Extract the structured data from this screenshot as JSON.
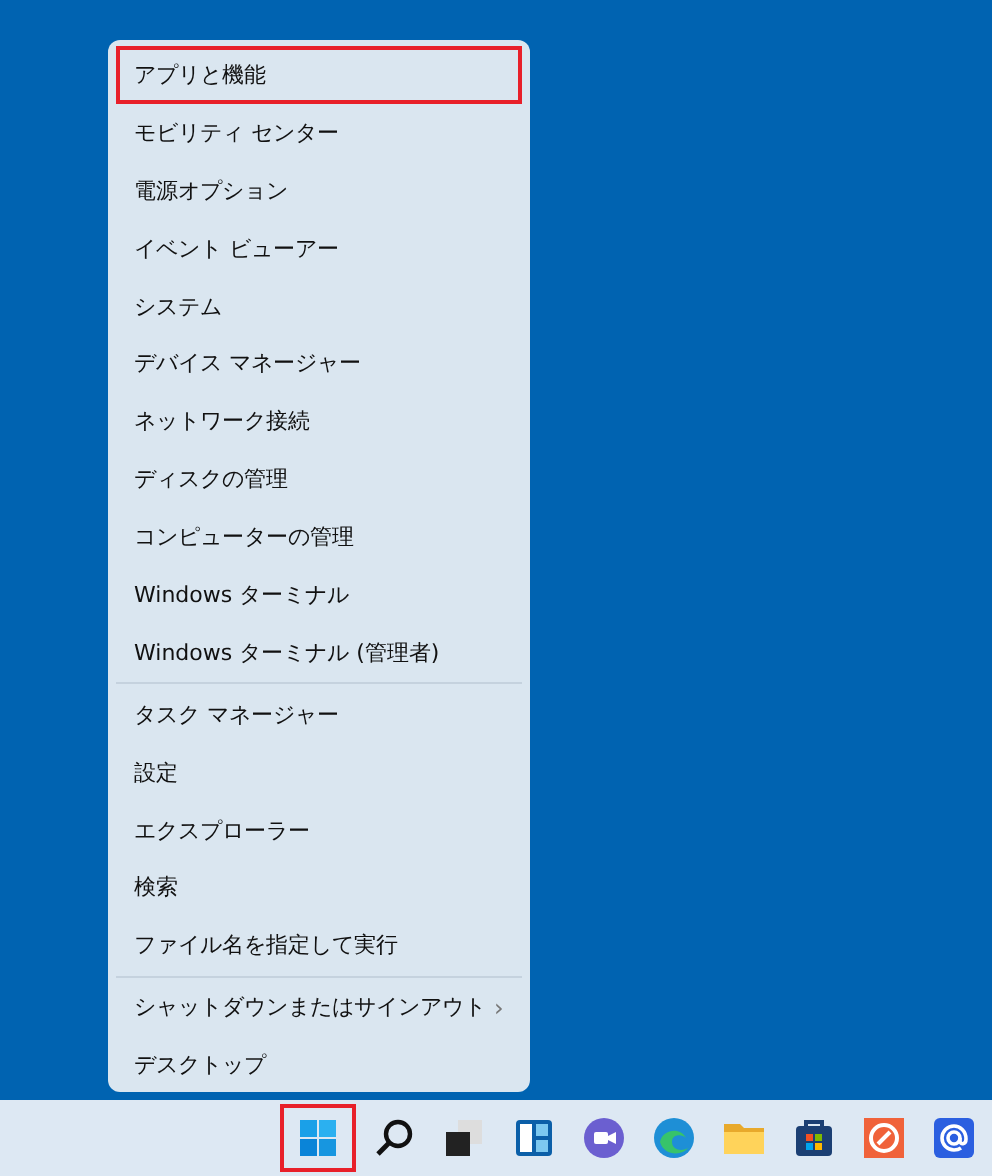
{
  "context_menu": {
    "groups": [
      {
        "items": [
          {
            "label": "アプリと機能",
            "highlighted": true
          },
          {
            "label": "モビリティ センター",
            "highlighted": false
          },
          {
            "label": "電源オプション",
            "highlighted": false
          },
          {
            "label": "イベント ビューアー",
            "highlighted": false
          },
          {
            "label": "システム",
            "highlighted": false
          },
          {
            "label": "デバイス マネージャー",
            "highlighted": false
          },
          {
            "label": "ネットワーク接続",
            "highlighted": false
          },
          {
            "label": "ディスクの管理",
            "highlighted": false
          },
          {
            "label": "コンピューターの管理",
            "highlighted": false
          },
          {
            "label": "Windows ターミナル",
            "highlighted": false
          },
          {
            "label": "Windows ターミナル (管理者)",
            "highlighted": false
          }
        ]
      },
      {
        "items": [
          {
            "label": "タスク マネージャー",
            "highlighted": false
          },
          {
            "label": "設定",
            "highlighted": false
          },
          {
            "label": "エクスプローラー",
            "highlighted": false
          },
          {
            "label": "検索",
            "highlighted": false
          },
          {
            "label": "ファイル名を指定して実行",
            "highlighted": false
          }
        ]
      },
      {
        "items": [
          {
            "label": "シャットダウンまたはサインアウト",
            "highlighted": false,
            "arrow": "›"
          },
          {
            "label": "デスクトップ",
            "highlighted": false
          }
        ]
      }
    ]
  },
  "taskbar": {
    "icons": [
      {
        "kind": "start",
        "highlighted": true
      },
      {
        "kind": "search",
        "highlighted": false
      },
      {
        "kind": "taskview",
        "highlighted": false
      },
      {
        "kind": "widgets",
        "highlighted": false
      },
      {
        "kind": "chat",
        "highlighted": false
      },
      {
        "kind": "edge",
        "highlighted": false
      },
      {
        "kind": "folder",
        "highlighted": false
      },
      {
        "kind": "store",
        "highlighted": false
      },
      {
        "kind": "app",
        "highlighted": false
      },
      {
        "kind": "mail",
        "highlighted": false
      }
    ]
  }
}
